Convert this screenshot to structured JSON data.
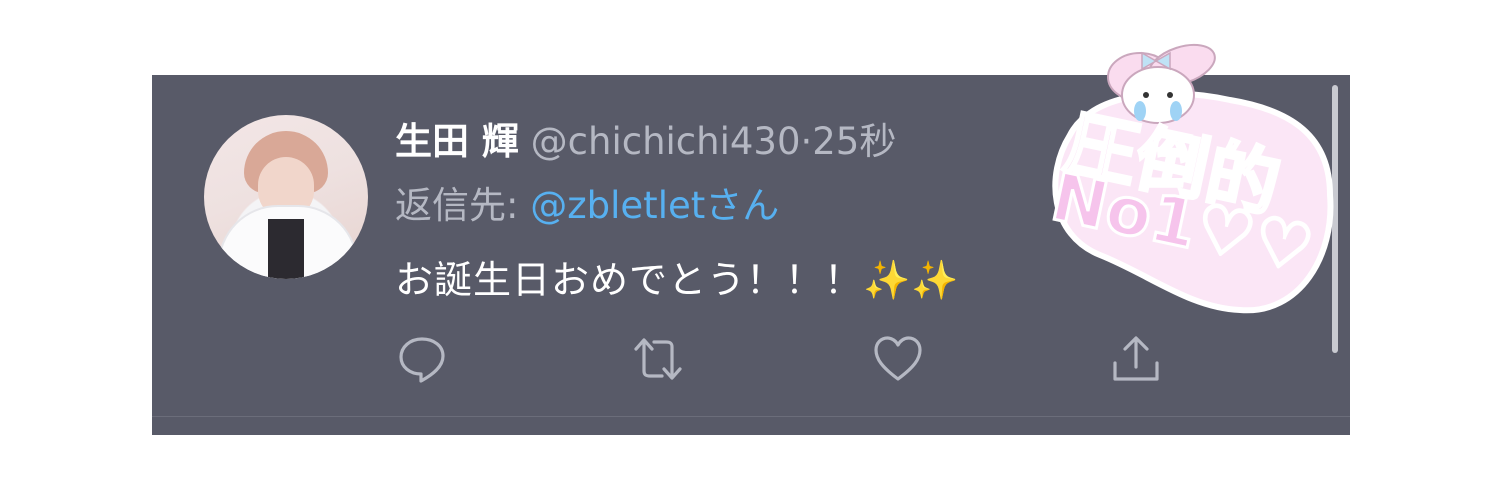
{
  "tweet": {
    "author_name": "生田 輝",
    "author_handle": "@chichichi430",
    "separator": "·",
    "timestamp": "25秒",
    "reply_label": "返信先: ",
    "reply_mention": "@zbletletさん",
    "text": "お誕生日おめでとう！！！",
    "emoji": "✨✨"
  },
  "actions": {
    "reply_icon": "reply-icon",
    "retweet_icon": "retweet-icon",
    "like_icon": "heart-icon",
    "share_icon": "share-icon"
  },
  "sticker": {
    "line1": "圧倒的",
    "line2": "No1♡♡"
  },
  "colors": {
    "card_bg": "#585a68",
    "mention_blue": "#57b0f0",
    "muted_text": "#b5b8c3",
    "sticker_pink": "#f6c4ec"
  }
}
